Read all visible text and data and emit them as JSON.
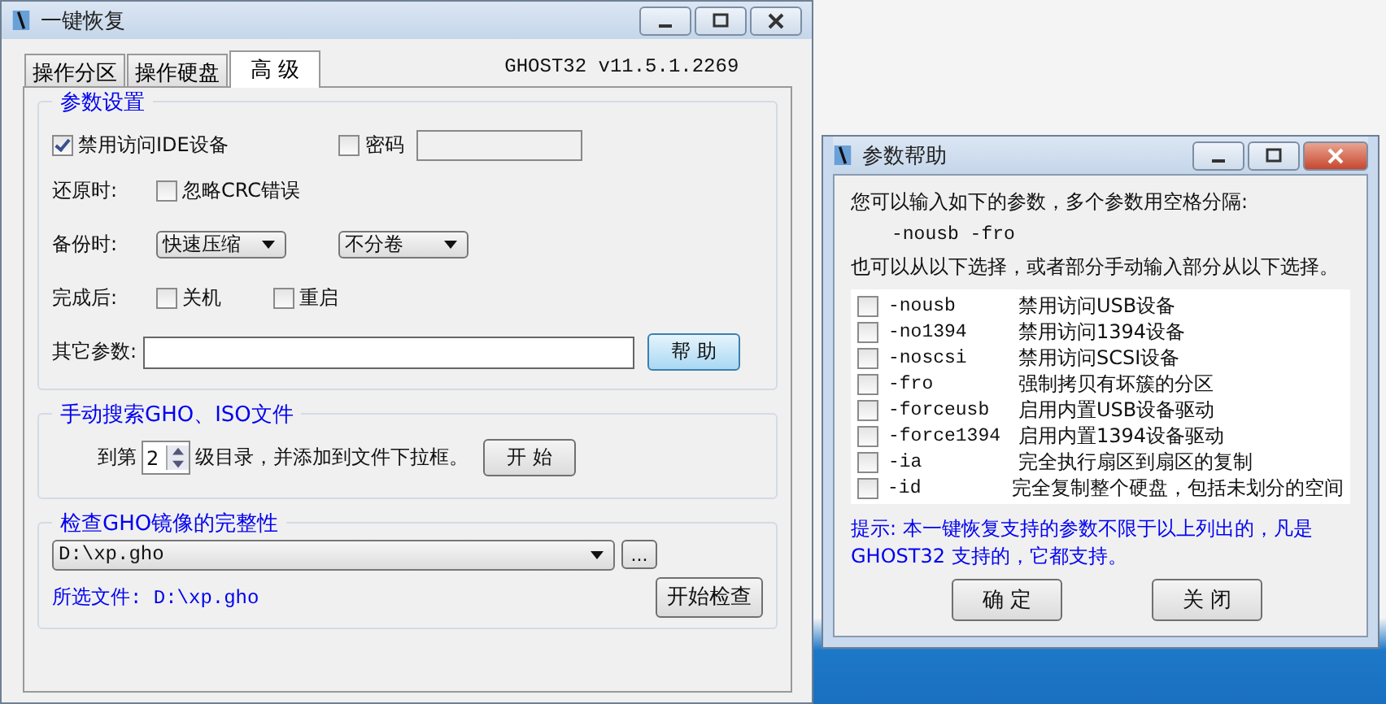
{
  "main_window": {
    "title": "一键恢复",
    "tabs": [
      {
        "label": "操作分区",
        "selected": false
      },
      {
        "label": "操作硬盘",
        "selected": false
      },
      {
        "label": "高 级",
        "selected": true
      }
    ],
    "version": "GHOST32 v11.5.1.2269",
    "params_group": {
      "title": "参数设置",
      "disable_ide": {
        "label": "禁用访问IDE设备",
        "checked": true
      },
      "password": {
        "label": "密码",
        "checked": false
      },
      "restore_label": "还原时:",
      "ignore_crc": {
        "label": "忽略CRC错误",
        "checked": false
      },
      "backup_label": "备份时:",
      "compression": "快速压缩",
      "split": "不分卷",
      "after_label": "完成后:",
      "shutdown": {
        "label": "关机",
        "checked": false
      },
      "reboot": {
        "label": "重启",
        "checked": false
      },
      "other_label": "其它参数:",
      "help_button": "帮 助"
    },
    "search_group": {
      "title": "手动搜索GHO、ISO文件",
      "prefix": "到第",
      "depth": "2",
      "suffix": "级目录，并添加到文件下拉框。",
      "start_button": "开 始"
    },
    "check_group": {
      "title": "检查GHO镜像的完整性",
      "file": "D:\\xp.gho",
      "browse_button": "...",
      "selected_label": "所选文件: D:\\xp.gho",
      "check_button": "开始检查"
    }
  },
  "help_dialog": {
    "title": "参数帮助",
    "intro": "您可以输入如下的参数，多个参数用空格分隔:",
    "example": "-nousb -fro",
    "intro2": "也可以从以下选择，或者部分手动输入部分从以下选择。",
    "options": [
      {
        "flag": "-nousb",
        "desc": "禁用访问USB设备",
        "checked": false
      },
      {
        "flag": "-no1394",
        "desc": "禁用访问1394设备",
        "checked": false
      },
      {
        "flag": "-noscsi",
        "desc": "禁用访问SCSI设备",
        "checked": false
      },
      {
        "flag": "-fro",
        "desc": "强制拷贝有坏簇的分区",
        "checked": false
      },
      {
        "flag": "-forceusb",
        "desc": "启用内置USB设备驱动",
        "checked": false
      },
      {
        "flag": "-force1394",
        "desc": "启用内置1394设备驱动",
        "checked": false
      },
      {
        "flag": "-ia",
        "desc": "完全执行扇区到扇区的复制",
        "checked": false
      },
      {
        "flag": "-id",
        "desc": "完全复制整个硬盘，包括未划分的空间",
        "checked": false
      }
    ],
    "tip": "提示: 本一键恢复支持的参数不限于以上列出的，凡是 GHOST32 支持的，它都支持。",
    "ok_button": "确 定",
    "close_button": "关 闭"
  }
}
